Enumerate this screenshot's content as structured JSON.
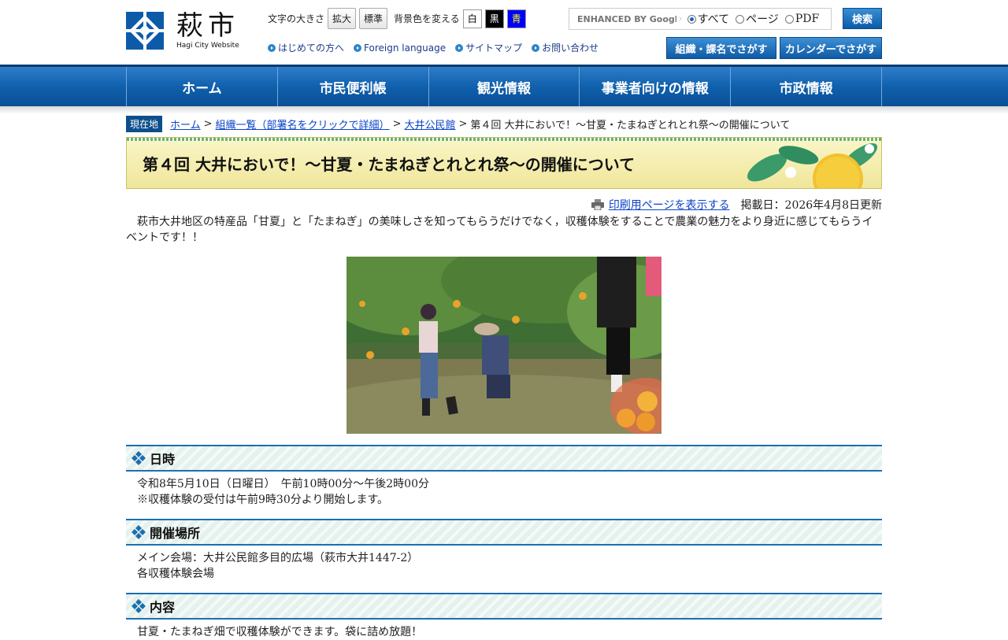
{
  "site": {
    "logo_text": "萩市",
    "logo_sub": "Hagi City Website"
  },
  "tools": {
    "text_size_label": "文字の大きさ",
    "enlarge": "拡大",
    "standard": "標準",
    "bg_label": "背景色を変える",
    "white": "白",
    "black": "黒",
    "blue": "青"
  },
  "search": {
    "placeholder": "ENHANCED BY Google",
    "options": [
      "すべて",
      "ページ",
      "PDF"
    ],
    "selected": "すべて",
    "button": "検索"
  },
  "sublinks": [
    "はじめての方へ",
    "Foreign language",
    "サイトマップ",
    "お問い合わせ"
  ],
  "quick_buttons": [
    "組織・課名でさがす",
    "カレンダーでさがす"
  ],
  "nav": [
    "ホーム",
    "市民便利帳",
    "観光情報",
    "事業者向けの情報",
    "市政情報"
  ],
  "breadcrumb": {
    "here_label": "現在地",
    "items": [
      "ホーム",
      "組織一覧（部署名をクリックで詳細）",
      "大井公民館"
    ],
    "current": "第４回 大井においで！～甘夏・たまねぎとれとれ祭～の開催について"
  },
  "page": {
    "title": "第４回 大井においで！～甘夏・たまねぎとれとれ祭～の開催について",
    "print_link": "印刷用ページを表示する",
    "updated": "掲載日：2026年4月8日更新",
    "lead": "萩市大井地区の特産品「甘夏」と「たまねぎ」の美味しさを知ってもらうだけでなく，収穫体験をすることで農業の魅力をより身近に感じてもらうイベントです！！"
  },
  "sections": [
    {
      "heading": "日時",
      "lines": [
        "令和8年5月10日（日曜日）　午前10時00分～午後2時00分",
        "※収穫体験の受付は午前9時30分より開始します。"
      ]
    },
    {
      "heading": "開催場所",
      "lines": [
        "メイン会場：大井公民館多目的広場（萩市大井1447-2）",
        "各収穫体験会場"
      ]
    },
    {
      "heading": "内容",
      "lines": [
        "甘夏・たまねぎ畑で収穫体験ができます。袋に詰め放題！"
      ]
    }
  ],
  "colors": {
    "brand_blue": "#0d5ba8",
    "link": "#0b43c6",
    "title_bg": "#f3eca8"
  }
}
